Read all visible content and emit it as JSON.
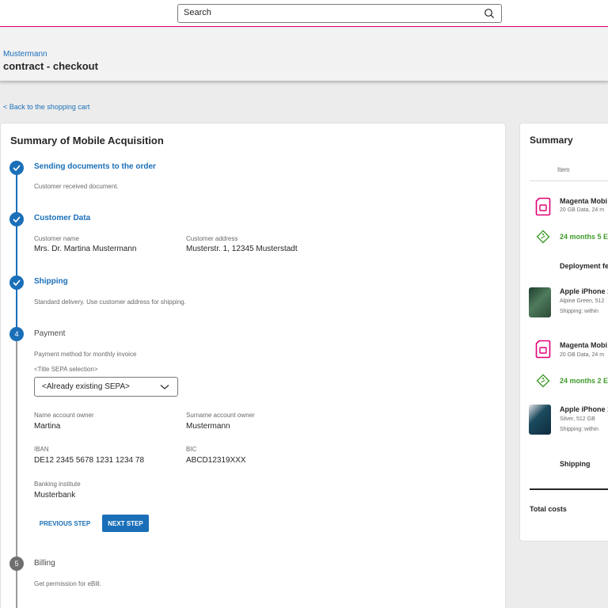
{
  "search": {
    "placeholder": "Search"
  },
  "header": {
    "customer": "Mustermann",
    "title": "contract - checkout"
  },
  "back_link": "Back to the shopping cart",
  "main": {
    "title": "Summary of Mobile Acquisition",
    "steps": [
      {
        "title": "Sending documents to the order",
        "status": "done",
        "description": "Customer received document."
      },
      {
        "title": "Customer Data",
        "status": "done",
        "fields": [
          {
            "label": "Customer name",
            "value": "Mrs. Dr. Martina Mustermann"
          },
          {
            "label": "Customer address",
            "value": "Musterstr. 1, 12345 Musterstadt"
          }
        ]
      },
      {
        "title": "Shipping",
        "status": "done",
        "description": "Standard delivery. Use customer address for shipping."
      },
      {
        "number": "4",
        "title": "Payment",
        "status": "active",
        "description": "Payment method for monthly invoice",
        "sepa_label": "<Title SEPA selection>",
        "sepa_selected": "<Already existing SEPA>",
        "fields": [
          {
            "label": "Name account owner",
            "value": "Martina"
          },
          {
            "label": "Surname account owner",
            "value": "Mustermann"
          },
          {
            "label": "IBAN",
            "value": "DE12 2345 5678 1231 1234 78"
          },
          {
            "label": "BIC",
            "value": "ABCD12319XXX"
          },
          {
            "label": "Banking institute",
            "value": "Musterbank"
          }
        ],
        "prev_label": "PREVIOUS STEP",
        "next_label": "NEXT STEP"
      },
      {
        "number": "5",
        "title": "Billing",
        "status": "pending",
        "description": "Get permission for eBill."
      }
    ]
  },
  "summary": {
    "title": "Summary",
    "item_header": "Item",
    "rows": [
      {
        "type": "tariff",
        "title": "Magenta Mobi",
        "sub": "20 GB Data, 24 m"
      },
      {
        "type": "promo",
        "title": "24 months 5 E"
      },
      {
        "type": "fee",
        "title": "Deployment fe"
      },
      {
        "type": "device",
        "title": "Apple iPhone 1",
        "sub": "Alpine Green, 512",
        "sub2": "Shipping: within"
      },
      {
        "type": "tariff",
        "title": "Magenta Mobi",
        "sub": "20 GB Data, 24 m"
      },
      {
        "type": "promo",
        "title": "24 months 2 E"
      },
      {
        "type": "device",
        "title": "Apple iPhone 1",
        "sub": "Silver, 512 GB",
        "sub2": "Shipping: within"
      },
      {
        "type": "fee",
        "title": "Shipping"
      }
    ],
    "total_label": "Total costs"
  },
  "colors": {
    "accent": "#1a6fb8",
    "brand": "#e20074",
    "promo": "#3f9b2a"
  }
}
